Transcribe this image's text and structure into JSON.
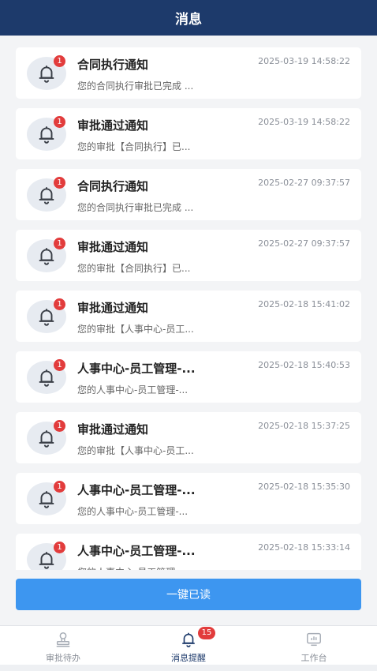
{
  "header": {
    "title": "消息"
  },
  "colors": {
    "header": "#1d3a6b",
    "accent": "#3d96f0",
    "badge": "#e23c3c",
    "active_tab": "#1d3a6b"
  },
  "messages": [
    {
      "title": "合同执行通知",
      "time": "2025-03-19 14:58:22",
      "desc": "您的合同执行审批已完成 ...",
      "badge": "1",
      "icon": "bell-icon"
    },
    {
      "title": "审批通过通知",
      "time": "2025-03-19 14:58:22",
      "desc": "您的审批【合同执行】已...",
      "badge": "1",
      "icon": "bell-icon"
    },
    {
      "title": "合同执行通知",
      "time": "2025-02-27 09:37:57",
      "desc": "您的合同执行审批已完成 ...",
      "badge": "1",
      "icon": "bell-icon"
    },
    {
      "title": "审批通过通知",
      "time": "2025-02-27 09:37:57",
      "desc": "您的审批【合同执行】已...",
      "badge": "1",
      "icon": "bell-icon"
    },
    {
      "title": "审批通过通知",
      "time": "2025-02-18 15:41:02",
      "desc": "您的审批【人事中心-员工...",
      "badge": "1",
      "icon": "bell-icon"
    },
    {
      "title": "人事中心-员工管理-...",
      "time": "2025-02-18 15:40:53",
      "desc": "您的人事中心-员工管理-...",
      "badge": "1",
      "icon": "bell-icon"
    },
    {
      "title": "审批通过通知",
      "time": "2025-02-18 15:37:25",
      "desc": "您的审批【人事中心-员工...",
      "badge": "1",
      "icon": "bell-icon"
    },
    {
      "title": "人事中心-员工管理-...",
      "time": "2025-02-18 15:35:30",
      "desc": "您的人事中心-员工管理-...",
      "badge": "1",
      "icon": "bell-icon"
    },
    {
      "title": "人事中心-员工管理-...",
      "time": "2025-02-18 15:33:14",
      "desc": "您的人事中心-员工管理-...",
      "badge": "1",
      "icon": "bell-icon"
    }
  ],
  "actions": {
    "read_all": "一键已读"
  },
  "tabbar": {
    "tabs": [
      {
        "label": "审批待办",
        "icon": "user-stamp-icon",
        "active": false
      },
      {
        "label": "消息提醒",
        "icon": "bell-icon",
        "active": true,
        "badge": "15"
      },
      {
        "label": "工作台",
        "icon": "monitor-icon",
        "active": false
      }
    ]
  }
}
